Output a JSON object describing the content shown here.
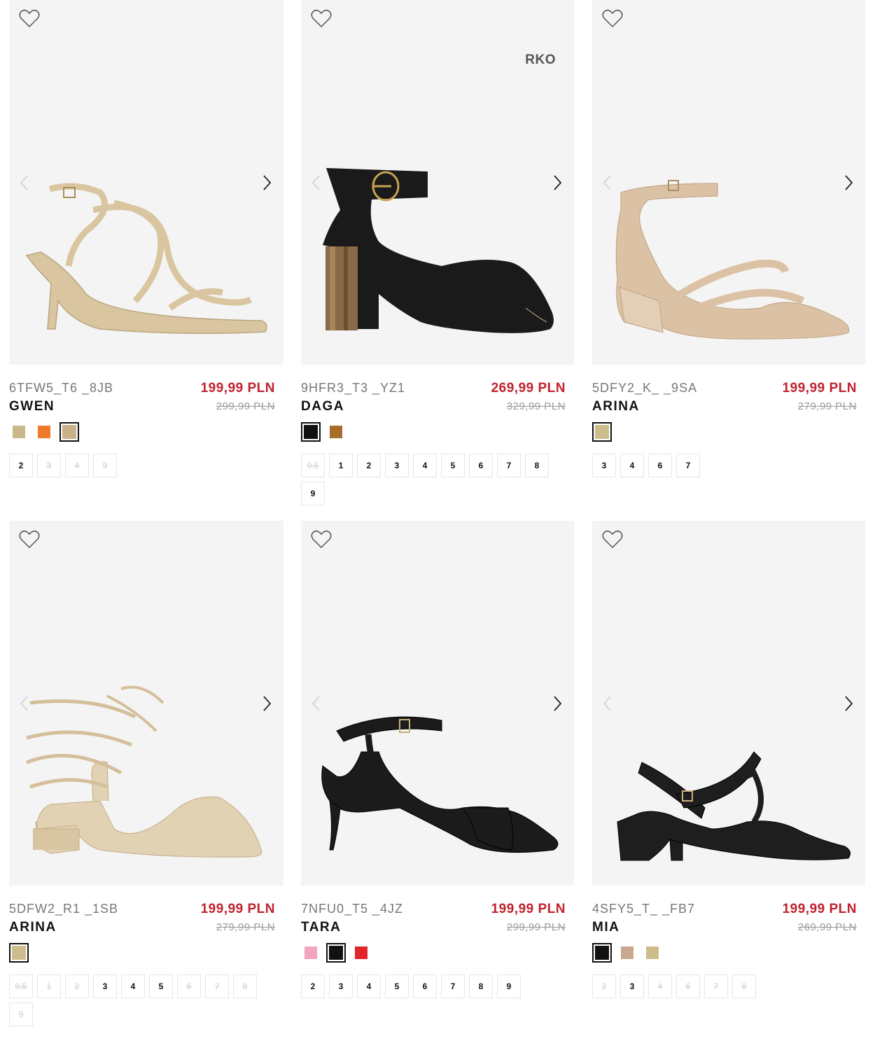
{
  "products": [
    {
      "code": "6TFW5_T6 _8JB",
      "name": "GWEN",
      "price": "199,99 PLN",
      "old_price": "299,99 PLN",
      "badge": "",
      "swatches": [
        {
          "color": "#c8b98a",
          "selected": false
        },
        {
          "color": "#f07a2a",
          "selected": false
        },
        {
          "color": "#cbb18a",
          "selected": true
        }
      ],
      "sizes": [
        {
          "label": "2",
          "available": true
        },
        {
          "label": "3",
          "available": false
        },
        {
          "label": "4",
          "available": false
        },
        {
          "label": "9",
          "available": false
        }
      ]
    },
    {
      "code": "9HFR3_T3 _YZ1",
      "name": "DAGA",
      "price": "269,99 PLN",
      "old_price": "329,99 PLN",
      "badge": "RKO",
      "swatches": [
        {
          "color": "#111111",
          "selected": true
        },
        {
          "color": "#a86d2c",
          "selected": false
        }
      ],
      "sizes": [
        {
          "label": "0.5",
          "available": false
        },
        {
          "label": "1",
          "available": true
        },
        {
          "label": "2",
          "available": true
        },
        {
          "label": "3",
          "available": true
        },
        {
          "label": "4",
          "available": true
        },
        {
          "label": "5",
          "available": true
        },
        {
          "label": "6",
          "available": true
        },
        {
          "label": "7",
          "available": true
        },
        {
          "label": "8",
          "available": true
        },
        {
          "label": "9",
          "available": true
        }
      ]
    },
    {
      "code": "5DFY2_K_ _9SA",
      "name": "ARINA",
      "price": "199,99 PLN",
      "old_price": "279,99 PLN",
      "badge": "",
      "swatches": [
        {
          "color": "#cdbd8c",
          "selected": true
        }
      ],
      "sizes": [
        {
          "label": "3",
          "available": true
        },
        {
          "label": "4",
          "available": true
        },
        {
          "label": "6",
          "available": true
        },
        {
          "label": "7",
          "available": true
        }
      ]
    },
    {
      "code": "5DFW2_R1 _1SB",
      "name": "ARINA",
      "price": "199,99 PLN",
      "old_price": "279,99 PLN",
      "badge": "",
      "swatches": [
        {
          "color": "#cdbd8c",
          "selected": true
        }
      ],
      "sizes": [
        {
          "label": "0.5",
          "available": false
        },
        {
          "label": "1",
          "available": false
        },
        {
          "label": "2",
          "available": false
        },
        {
          "label": "3",
          "available": true
        },
        {
          "label": "4",
          "available": true
        },
        {
          "label": "5",
          "available": true
        },
        {
          "label": "6",
          "available": false
        },
        {
          "label": "7",
          "available": false
        },
        {
          "label": "8",
          "available": false
        },
        {
          "label": "9",
          "available": false
        }
      ]
    },
    {
      "code": "7NFU0_T5 _4JZ",
      "name": "TARA",
      "price": "199,99 PLN",
      "old_price": "299,99 PLN",
      "badge": "",
      "swatches": [
        {
          "color": "#f4a3c0",
          "selected": false
        },
        {
          "color": "#111111",
          "selected": true
        },
        {
          "color": "#e0262b",
          "selected": false
        }
      ],
      "sizes": [
        {
          "label": "2",
          "available": true
        },
        {
          "label": "3",
          "available": true
        },
        {
          "label": "4",
          "available": true
        },
        {
          "label": "5",
          "available": true
        },
        {
          "label": "6",
          "available": true
        },
        {
          "label": "7",
          "available": true
        },
        {
          "label": "8",
          "available": true
        },
        {
          "label": "9",
          "available": true
        }
      ]
    },
    {
      "code": "4SFY5_T_ _FB7",
      "name": "MIA",
      "price": "199,99 PLN",
      "old_price": "269,99 PLN",
      "badge": "",
      "swatches": [
        {
          "color": "#111111",
          "selected": true
        },
        {
          "color": "#c8a890",
          "selected": false
        },
        {
          "color": "#cdbd8c",
          "selected": false
        }
      ],
      "sizes": [
        {
          "label": "2",
          "available": false
        },
        {
          "label": "3",
          "available": true
        },
        {
          "label": "4",
          "available": false
        },
        {
          "label": "6",
          "available": false
        },
        {
          "label": "7",
          "available": false
        },
        {
          "label": "8",
          "available": false
        }
      ]
    }
  ]
}
